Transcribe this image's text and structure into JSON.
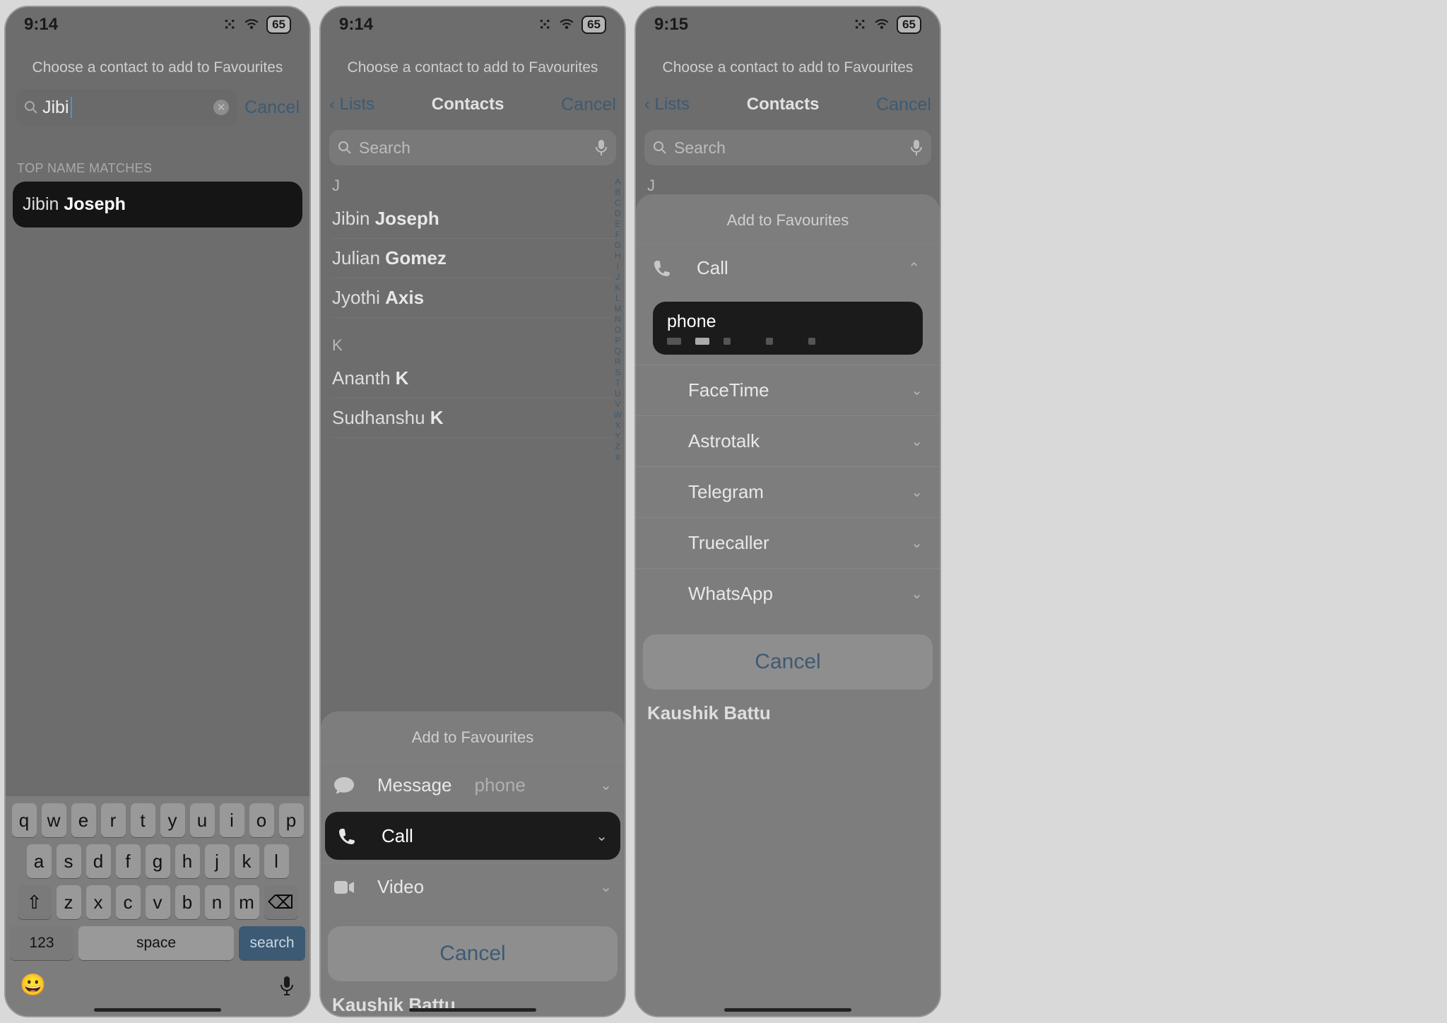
{
  "status": {
    "battery": "65"
  },
  "screens": {
    "s1": {
      "time": "9:14",
      "title": "Choose a contact to add to Favourites",
      "search_value": "Jibi",
      "cancel": "Cancel",
      "section": "TOP NAME MATCHES",
      "match_first": "Jibin ",
      "match_last": "Joseph",
      "keyboard": {
        "r1": [
          "q",
          "w",
          "e",
          "r",
          "t",
          "y",
          "u",
          "i",
          "o",
          "p"
        ],
        "r2": [
          "a",
          "s",
          "d",
          "f",
          "g",
          "h",
          "j",
          "k",
          "l"
        ],
        "r3": [
          "z",
          "x",
          "c",
          "v",
          "b",
          "n",
          "m"
        ],
        "num": "123",
        "space": "space",
        "search": "search"
      }
    },
    "s2": {
      "time": "9:14",
      "title": "Choose a contact to add to Favourites",
      "back": "Lists",
      "heading": "Contacts",
      "cancel": "Cancel",
      "search_placeholder": "Search",
      "sections": {
        "J": [
          {
            "first": "Jibin ",
            "last": "Joseph"
          },
          {
            "first": "Julian ",
            "last": "Gomez"
          },
          {
            "first": "Jyothi ",
            "last": "Axis"
          }
        ],
        "K": [
          {
            "first": "Ananth ",
            "last": "K"
          },
          {
            "first": "Sudhanshu ",
            "last": "K"
          }
        ]
      },
      "index": "ABCDEFGHIJKLMNOPQRSTUVWXYZ#",
      "sheet": {
        "title": "Add to Favourites",
        "rows": [
          {
            "icon": "message",
            "label": "Message",
            "sub": "phone"
          },
          {
            "icon": "call",
            "label": "Call"
          },
          {
            "icon": "video",
            "label": "Video"
          }
        ],
        "cancel": "Cancel"
      },
      "peek": "Kaushik Battu"
    },
    "s3": {
      "time": "9:15",
      "title": "Choose a contact to add to Favourites",
      "back": "Lists",
      "heading": "Contacts",
      "cancel": "Cancel",
      "search_placeholder": "Search",
      "letter": "J",
      "sheet": {
        "title": "Add to Favourites",
        "call": "Call",
        "expanded_label": "phone",
        "providers": [
          "FaceTime",
          "Astrotalk",
          "Telegram",
          "Truecaller",
          "WhatsApp"
        ],
        "cancel": "Cancel"
      },
      "peek": "Kaushik Battu"
    }
  }
}
